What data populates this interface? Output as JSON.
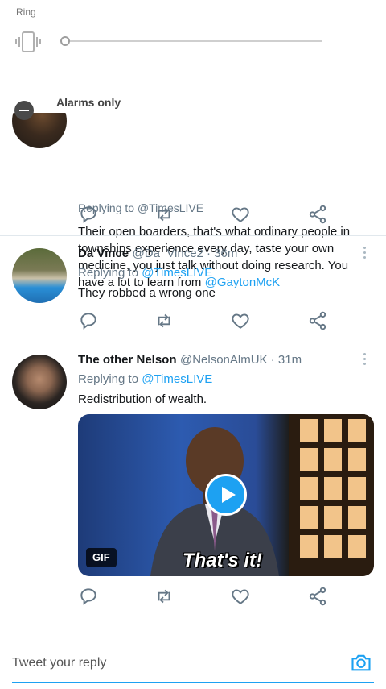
{
  "volume_panel": {
    "ring_label": "Ring",
    "ring_level": 0,
    "alarms_label": "Alarms only"
  },
  "tweets": [
    {
      "partial_reply_to": "Replying to @TimesLIVE",
      "body_parts": [
        "Their open boarders, that's what ordinary people in townships experience every day, taste your own medicine, you just talk without doing research. You have a lot to learn from ",
        "@GaytonMcK"
      ]
    },
    {
      "name": "Da Vince",
      "handle": "@Da_Vince2 · 36m",
      "replying_label": "Replying to ",
      "replying_mention": "@TimesLIVE",
      "body": "They robbed a wrong one"
    },
    {
      "name": "The other Nelson",
      "handle": "@NelsonAlmUK · 31m",
      "replying_label": "Replying to ",
      "replying_mention": "@TimesLIVE",
      "body": "Redistribution of wealth.",
      "media": {
        "badge": "GIF",
        "caption": "That's it!"
      }
    }
  ],
  "reply_bar": {
    "placeholder": "Tweet your reply"
  },
  "colors": {
    "accent": "#1da1f2",
    "secondary_text": "#657786",
    "icon_gray": "#657786"
  },
  "icons": [
    "vibrate-icon",
    "dnd-icon",
    "reply-icon",
    "retweet-icon",
    "like-icon",
    "share-icon",
    "more-icon",
    "play-icon",
    "camera-icon"
  ]
}
